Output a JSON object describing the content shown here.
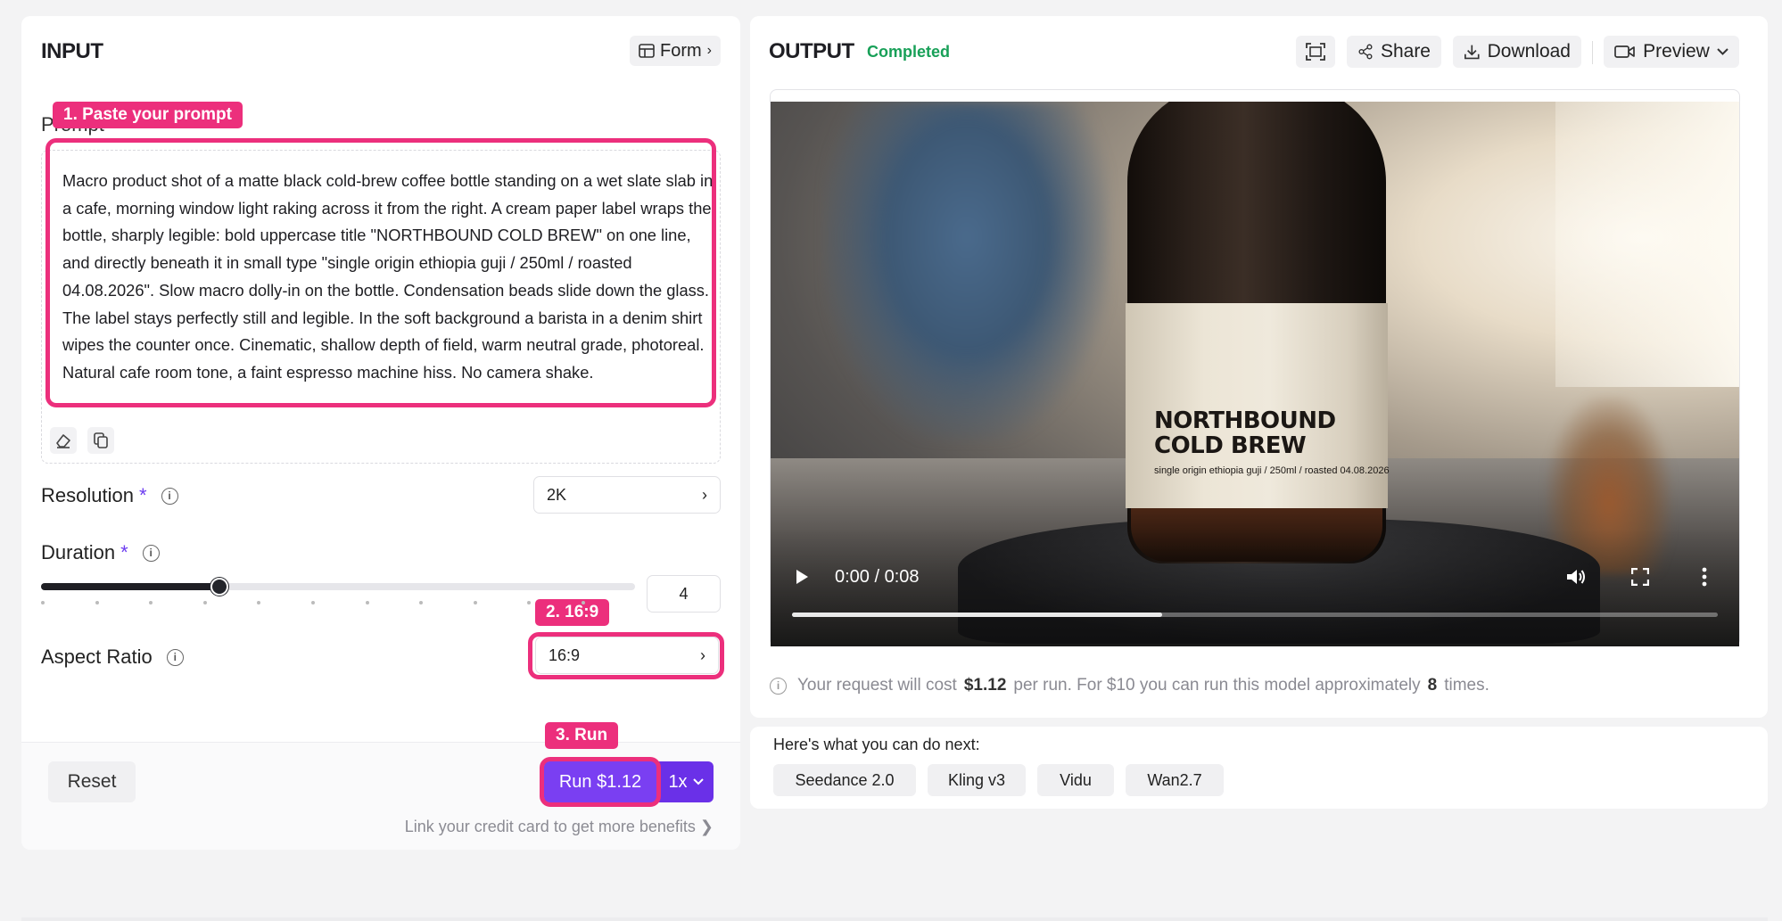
{
  "input": {
    "title": "INPUT",
    "form_toggle_label": "Form",
    "prompt_label": "Prompt",
    "prompt_text": "Macro product shot of a matte black cold-brew coffee bottle standing on a wet slate slab in a cafe, morning window light raking across it from the right. A cream paper label wraps the bottle, sharply legible: bold uppercase title \"NORTHBOUND COLD BREW\" on one line, and directly beneath it in small type \"single origin ethiopia guji / 250ml / roasted 04.08.2026\". Slow macro dolly-in on the bottle. Condensation beads slide down the glass. The label stays perfectly still and legible. In the soft background a barista in a denim shirt wipes the counter once. Cinematic, shallow depth of field, warm neutral grade, photoreal. Natural cafe room tone, a faint espresso machine hiss. No camera shake.",
    "resolution": {
      "label": "Resolution",
      "required_mark": "*",
      "value": "2K"
    },
    "duration": {
      "label": "Duration",
      "required_mark": "*",
      "value": "4",
      "fraction": 0.3
    },
    "aspect_ratio": {
      "label": "Aspect Ratio",
      "value": "16:9"
    },
    "reset_label": "Reset",
    "run_label": "Run $1.12",
    "multiplier_label": "1x",
    "credit_link": "Link your credit card to get more benefits ❯"
  },
  "annotations": {
    "step1": "1. Paste your prompt",
    "step2": "2. 16:9",
    "step3": "3. Run"
  },
  "output": {
    "title": "OUTPUT",
    "status": "Completed",
    "share_label": "Share",
    "download_label": "Download",
    "preview_label": "Preview",
    "video": {
      "label_title_line1": "NORTHBOUND",
      "label_title_line2": "COLD BREW",
      "label_subtitle": "single origin ethiopia guji / 250ml / roasted 04.08.2026",
      "time": "0:00 / 0:08",
      "buffered_fraction": 0.4
    },
    "cost": {
      "prefix": "Your request will cost",
      "price": "$1.12",
      "middle": "per run. For $10 you can run this model approximately",
      "count": "8",
      "suffix": "times."
    }
  },
  "next": {
    "title": "Here's what you can do next:",
    "models": [
      "Seedance 2.0",
      "Kling v3",
      "Vidu",
      "Wan2.7"
    ]
  },
  "colors": {
    "accent": "#7a3ff2",
    "highlight": "#ec2f7c",
    "success": "#18a058"
  }
}
